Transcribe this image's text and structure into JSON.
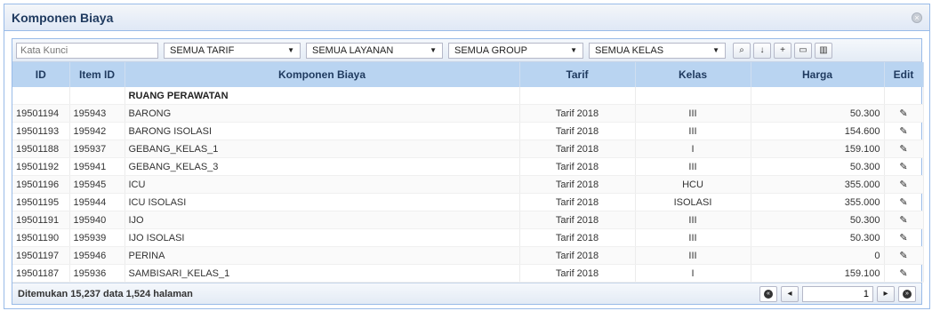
{
  "panel": {
    "title": "Komponen Biaya"
  },
  "toolbar": {
    "search_placeholder": "Kata Kunci",
    "filters": [
      "SEMUA TARIF",
      "SEMUA LAYANAN",
      "SEMUA GROUP",
      "SEMUA KELAS"
    ],
    "icons": [
      "search-icon",
      "download-icon",
      "add-icon",
      "copy-icon",
      "delete-icon"
    ]
  },
  "table": {
    "headers": [
      "ID",
      "Item ID",
      "Komponen Biaya",
      "Tarif",
      "Kelas",
      "Harga",
      "Edit"
    ],
    "group_label": "RUANG PERAWATAN",
    "rows": [
      [
        "19501194",
        "195943",
        "BARONG",
        "Tarif 2018",
        "III",
        "50.300"
      ],
      [
        "19501193",
        "195942",
        "BARONG ISOLASI",
        "Tarif 2018",
        "III",
        "154.600"
      ],
      [
        "19501188",
        "195937",
        "GEBANG_KELAS_1",
        "Tarif 2018",
        "I",
        "159.100"
      ],
      [
        "19501192",
        "195941",
        "GEBANG_KELAS_3",
        "Tarif 2018",
        "III",
        "50.300"
      ],
      [
        "19501196",
        "195945",
        "ICU",
        "Tarif 2018",
        "HCU",
        "355.000"
      ],
      [
        "19501195",
        "195944",
        "ICU ISOLASI",
        "Tarif 2018",
        "ISOLASI",
        "355.000"
      ],
      [
        "19501191",
        "195940",
        "IJO",
        "Tarif 2018",
        "III",
        "50.300"
      ],
      [
        "19501190",
        "195939",
        "IJO ISOLASI",
        "Tarif 2018",
        "III",
        "50.300"
      ],
      [
        "19501197",
        "195946",
        "PERINA",
        "Tarif 2018",
        "III",
        "0"
      ],
      [
        "19501187",
        "195936",
        "SAMBISARI_KELAS_1",
        "Tarif 2018",
        "I",
        "159.100"
      ]
    ]
  },
  "footer": {
    "summary": "Ditemukan 15,237 data 1,524 halaman",
    "page": "1"
  },
  "colors": {
    "header_bg": "#b9d4f1",
    "border": "#99bbe8"
  }
}
